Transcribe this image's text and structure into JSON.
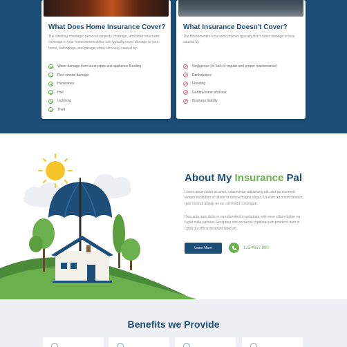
{
  "coverage_cards": {
    "covered": {
      "title": "What Does Home Insurance Cover?",
      "description": "The dwelling coverage, personal property coverage, and other structures coverage in your homeowners policy can typically cover damage to your home, belongings, and garage, shed, driveway caused by:",
      "items": [
        "Water damage from burst pipes and appliance flooding",
        "Fire/ smoke damage",
        "Hurricanes",
        "Hail",
        "Lightning",
        "Theft"
      ]
    },
    "not_covered": {
      "title": "What Insurance Doesn't Cover?",
      "description": "The Homeowners Insurance policies typically don't cover damage or loss caused by:",
      "items": [
        "Negligence (or lack of regular and proper maintenance)",
        "Earthquakes",
        "Flooding",
        "General wear and tear",
        "Business liability"
      ]
    }
  },
  "about": {
    "title_main": "About My ",
    "title_accent": "Insurance",
    "title_end": " Pal",
    "paragraph1": "Lorem ipsum dolor sit amet, consectetur adipisicing elit, sed do eiusmod tempor incididunt ut labore et dolore magna aliqua. Ut enim ad minim veniam, quis nostrud aliquip ex ea commodo consequat.",
    "paragraph2": "Duis aute irure dolor in reprehenderit in voluptate velit esse cillum dolore eu fugiat nulla pariatur. Excepteur sint occaecat cupidatat non proident, sunt in culpa qui officia deserunt laborum.",
    "button_label": "Learn More",
    "phone": "123 4567 890"
  },
  "benefits": {
    "title": "Benefits we Provide"
  },
  "colors": {
    "brand_blue": "#1c4e78",
    "accent_green": "#6ab04c",
    "alert_pink": "#e06a7a"
  }
}
